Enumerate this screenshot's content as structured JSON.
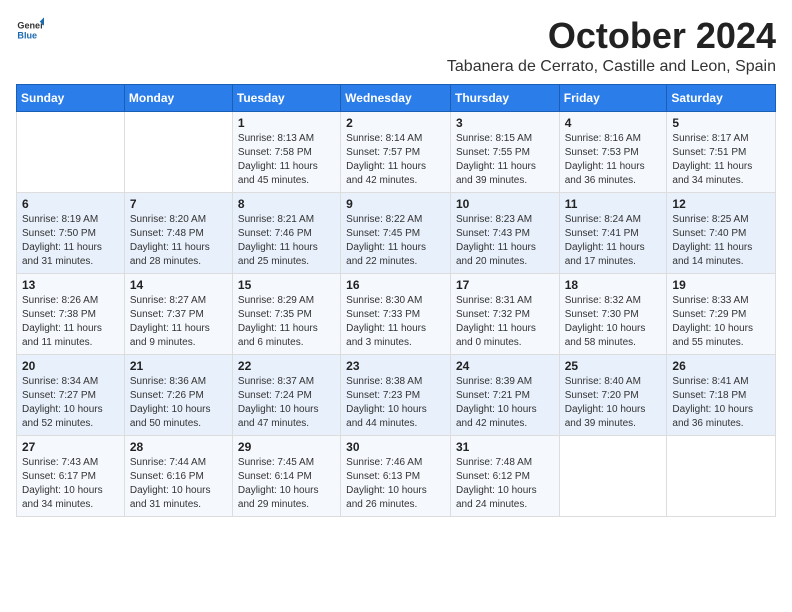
{
  "header": {
    "logo_general": "General",
    "logo_blue": "Blue",
    "month_title": "October 2024",
    "location": "Tabanera de Cerrato, Castille and Leon, Spain"
  },
  "days_of_week": [
    "Sunday",
    "Monday",
    "Tuesday",
    "Wednesday",
    "Thursday",
    "Friday",
    "Saturday"
  ],
  "weeks": [
    [
      {
        "day": "",
        "info": ""
      },
      {
        "day": "",
        "info": ""
      },
      {
        "day": "1",
        "info": "Sunrise: 8:13 AM\nSunset: 7:58 PM\nDaylight: 11 hours and 45 minutes."
      },
      {
        "day": "2",
        "info": "Sunrise: 8:14 AM\nSunset: 7:57 PM\nDaylight: 11 hours and 42 minutes."
      },
      {
        "day": "3",
        "info": "Sunrise: 8:15 AM\nSunset: 7:55 PM\nDaylight: 11 hours and 39 minutes."
      },
      {
        "day": "4",
        "info": "Sunrise: 8:16 AM\nSunset: 7:53 PM\nDaylight: 11 hours and 36 minutes."
      },
      {
        "day": "5",
        "info": "Sunrise: 8:17 AM\nSunset: 7:51 PM\nDaylight: 11 hours and 34 minutes."
      }
    ],
    [
      {
        "day": "6",
        "info": "Sunrise: 8:19 AM\nSunset: 7:50 PM\nDaylight: 11 hours and 31 minutes."
      },
      {
        "day": "7",
        "info": "Sunrise: 8:20 AM\nSunset: 7:48 PM\nDaylight: 11 hours and 28 minutes."
      },
      {
        "day": "8",
        "info": "Sunrise: 8:21 AM\nSunset: 7:46 PM\nDaylight: 11 hours and 25 minutes."
      },
      {
        "day": "9",
        "info": "Sunrise: 8:22 AM\nSunset: 7:45 PM\nDaylight: 11 hours and 22 minutes."
      },
      {
        "day": "10",
        "info": "Sunrise: 8:23 AM\nSunset: 7:43 PM\nDaylight: 11 hours and 20 minutes."
      },
      {
        "day": "11",
        "info": "Sunrise: 8:24 AM\nSunset: 7:41 PM\nDaylight: 11 hours and 17 minutes."
      },
      {
        "day": "12",
        "info": "Sunrise: 8:25 AM\nSunset: 7:40 PM\nDaylight: 11 hours and 14 minutes."
      }
    ],
    [
      {
        "day": "13",
        "info": "Sunrise: 8:26 AM\nSunset: 7:38 PM\nDaylight: 11 hours and 11 minutes."
      },
      {
        "day": "14",
        "info": "Sunrise: 8:27 AM\nSunset: 7:37 PM\nDaylight: 11 hours and 9 minutes."
      },
      {
        "day": "15",
        "info": "Sunrise: 8:29 AM\nSunset: 7:35 PM\nDaylight: 11 hours and 6 minutes."
      },
      {
        "day": "16",
        "info": "Sunrise: 8:30 AM\nSunset: 7:33 PM\nDaylight: 11 hours and 3 minutes."
      },
      {
        "day": "17",
        "info": "Sunrise: 8:31 AM\nSunset: 7:32 PM\nDaylight: 11 hours and 0 minutes."
      },
      {
        "day": "18",
        "info": "Sunrise: 8:32 AM\nSunset: 7:30 PM\nDaylight: 10 hours and 58 minutes."
      },
      {
        "day": "19",
        "info": "Sunrise: 8:33 AM\nSunset: 7:29 PM\nDaylight: 10 hours and 55 minutes."
      }
    ],
    [
      {
        "day": "20",
        "info": "Sunrise: 8:34 AM\nSunset: 7:27 PM\nDaylight: 10 hours and 52 minutes."
      },
      {
        "day": "21",
        "info": "Sunrise: 8:36 AM\nSunset: 7:26 PM\nDaylight: 10 hours and 50 minutes."
      },
      {
        "day": "22",
        "info": "Sunrise: 8:37 AM\nSunset: 7:24 PM\nDaylight: 10 hours and 47 minutes."
      },
      {
        "day": "23",
        "info": "Sunrise: 8:38 AM\nSunset: 7:23 PM\nDaylight: 10 hours and 44 minutes."
      },
      {
        "day": "24",
        "info": "Sunrise: 8:39 AM\nSunset: 7:21 PM\nDaylight: 10 hours and 42 minutes."
      },
      {
        "day": "25",
        "info": "Sunrise: 8:40 AM\nSunset: 7:20 PM\nDaylight: 10 hours and 39 minutes."
      },
      {
        "day": "26",
        "info": "Sunrise: 8:41 AM\nSunset: 7:18 PM\nDaylight: 10 hours and 36 minutes."
      }
    ],
    [
      {
        "day": "27",
        "info": "Sunrise: 7:43 AM\nSunset: 6:17 PM\nDaylight: 10 hours and 34 minutes."
      },
      {
        "day": "28",
        "info": "Sunrise: 7:44 AM\nSunset: 6:16 PM\nDaylight: 10 hours and 31 minutes."
      },
      {
        "day": "29",
        "info": "Sunrise: 7:45 AM\nSunset: 6:14 PM\nDaylight: 10 hours and 29 minutes."
      },
      {
        "day": "30",
        "info": "Sunrise: 7:46 AM\nSunset: 6:13 PM\nDaylight: 10 hours and 26 minutes."
      },
      {
        "day": "31",
        "info": "Sunrise: 7:48 AM\nSunset: 6:12 PM\nDaylight: 10 hours and 24 minutes."
      },
      {
        "day": "",
        "info": ""
      },
      {
        "day": "",
        "info": ""
      }
    ]
  ]
}
